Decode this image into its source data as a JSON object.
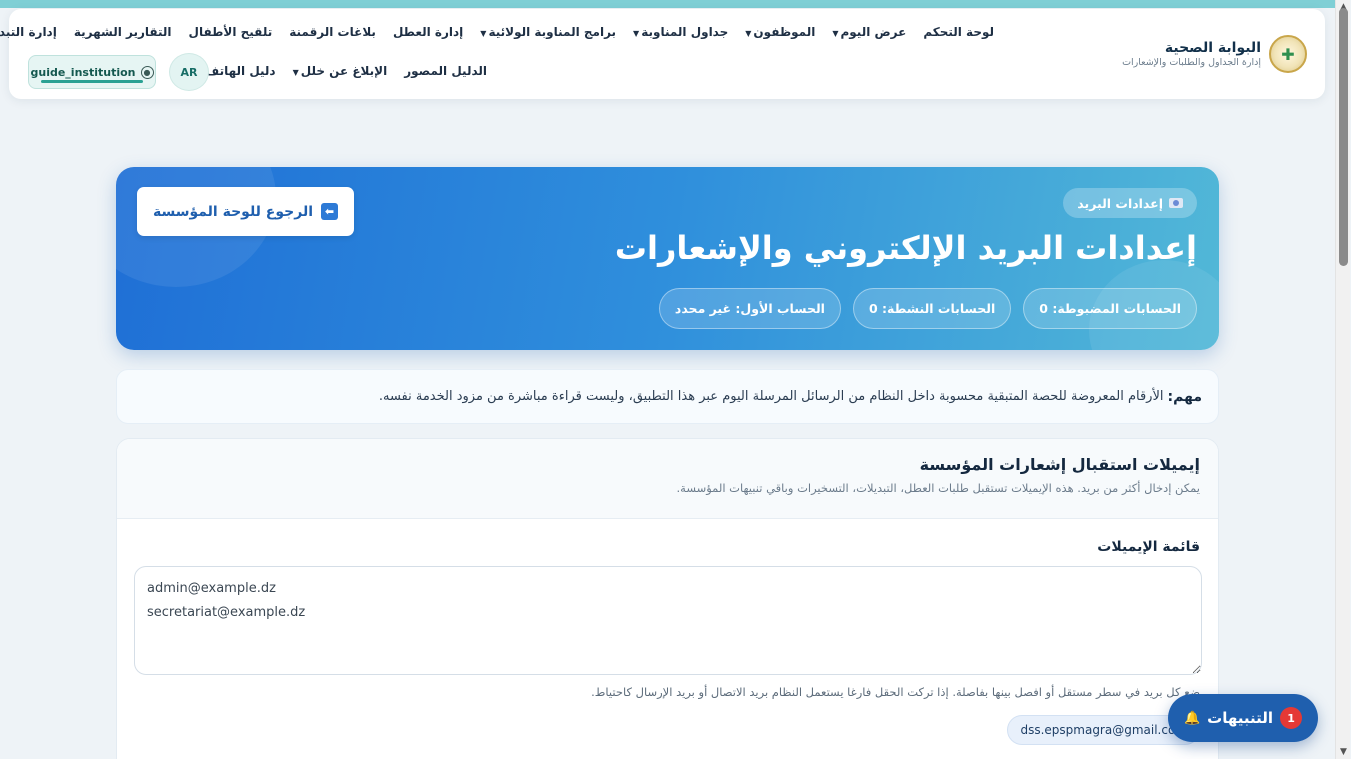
{
  "brand": {
    "title": "البوابة الصحية",
    "subtitle": "إدارة الجداول والطلبات والإشعارات"
  },
  "nav": {
    "row1": [
      {
        "label": "لوحة التحكم",
        "dropdown": false
      },
      {
        "label": "عرض اليوم",
        "dropdown": true
      },
      {
        "label": "الموظفون",
        "dropdown": true
      },
      {
        "label": "جداول المناوبة",
        "dropdown": true
      },
      {
        "label": "برامج المناوبة الولائية",
        "dropdown": true
      },
      {
        "label": "إدارة العطل",
        "dropdown": false
      },
      {
        "label": "بلاغات الرقمنة",
        "dropdown": false
      },
      {
        "label": "تلقيح الأطفال",
        "dropdown": false
      },
      {
        "label": "التقارير الشهرية",
        "dropdown": false
      },
      {
        "label": "إدارة التبديلات",
        "dropdown": false
      }
    ],
    "row2": [
      {
        "label": "الدليل المصور",
        "dropdown": false
      },
      {
        "label": "الإبلاغ عن خلل",
        "dropdown": true
      },
      {
        "label": "دليل الهاتف",
        "dropdown": false
      }
    ],
    "language": "AR",
    "username": "guide_institution"
  },
  "hero": {
    "pill": "إعدادات البريد",
    "title": "إعدادات البريد الإلكتروني والإشعارات",
    "stats": [
      "الحسابات المضبوطة: 0",
      "الحسابات النشطة: 0",
      "الحساب الأول: غير محدد"
    ],
    "back_label": "الرجوع للوحة المؤسسة"
  },
  "notice": {
    "strong": "مهم:",
    "text": "الأرقام المعروضة للحصة المتبقية محسوبة داخل النظام من الرسائل المرسلة اليوم عبر هذا التطبيق، وليست قراءة مباشرة من مزود الخدمة نفسه."
  },
  "recipients": {
    "title": "إيميلات استقبال إشعارات المؤسسة",
    "description": "يمكن إدخال أكثر من بريد. هذه الإيميلات تستقبل طلبات العطل، التبديلات، التسخيرات وباقي تنبيهات المؤسسة.",
    "list_label": "قائمة الإيميلات",
    "emails_value": "admin@example.dz\nsecretariat@example.dz",
    "help": "ضع كل بريد في سطر مستقل أو افصل بينها بفاصلة. إذا تركت الحقل فارغا يستعمل النظام بريد الاتصال أو بريد الإرسال كاحتياط.",
    "fallback_email": "dss.epspmagra@gmail.com"
  },
  "notifications": {
    "label": "التنبيهات",
    "count": "1"
  }
}
